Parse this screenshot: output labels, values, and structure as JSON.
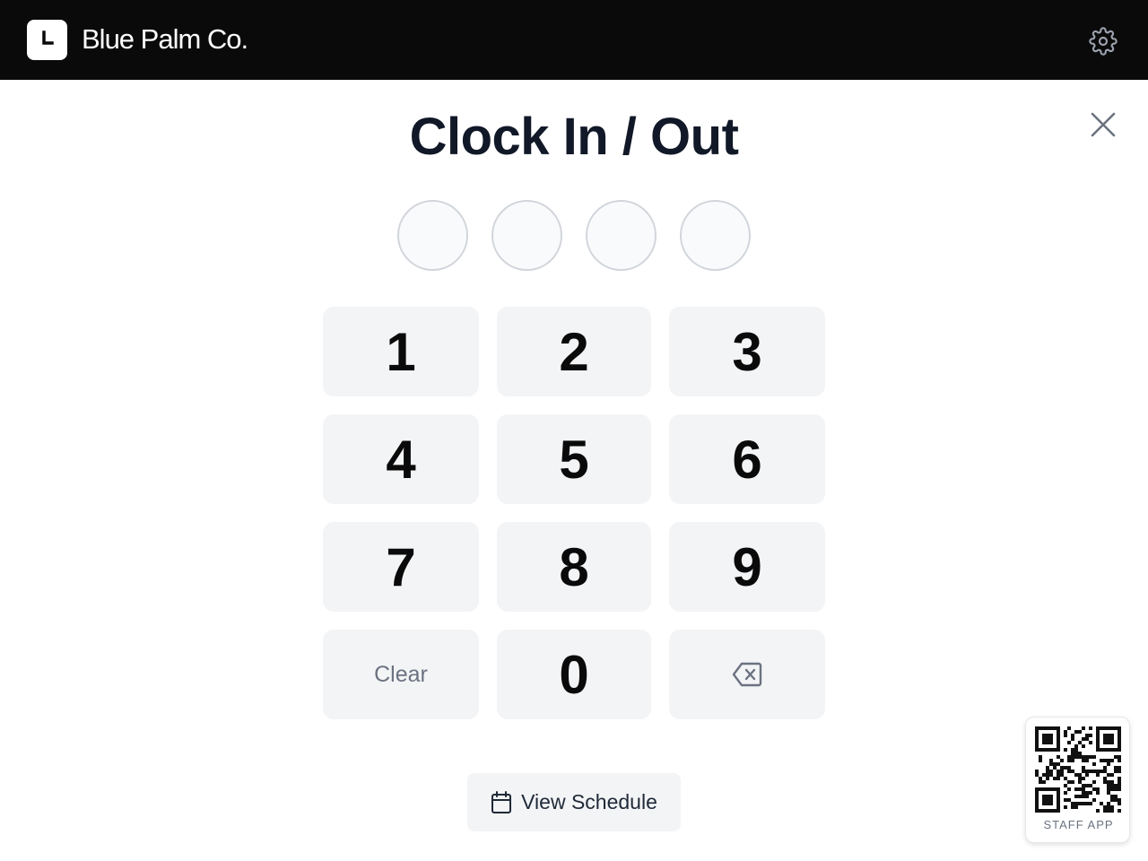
{
  "header": {
    "brand_name": "Blue Palm Co.",
    "logo_icon": "clock-icon",
    "settings_icon": "gear-icon"
  },
  "main": {
    "title": "Clock In / Out",
    "close_icon": "close-icon",
    "pin_length": 4,
    "pin_filled": 0,
    "keys": {
      "k1": "1",
      "k2": "2",
      "k3": "3",
      "k4": "4",
      "k5": "5",
      "k6": "6",
      "k7": "7",
      "k8": "8",
      "k9": "9",
      "clear": "Clear",
      "k0": "0",
      "backspace_icon": "backspace-icon"
    },
    "schedule_button": {
      "label": "View Schedule",
      "icon": "calendar-icon"
    }
  },
  "qr": {
    "label": "STAFF APP"
  },
  "colors": {
    "header_bg": "#0a0a0a",
    "title": "#111827",
    "key_bg": "#f3f4f6",
    "muted": "#6b7280"
  }
}
